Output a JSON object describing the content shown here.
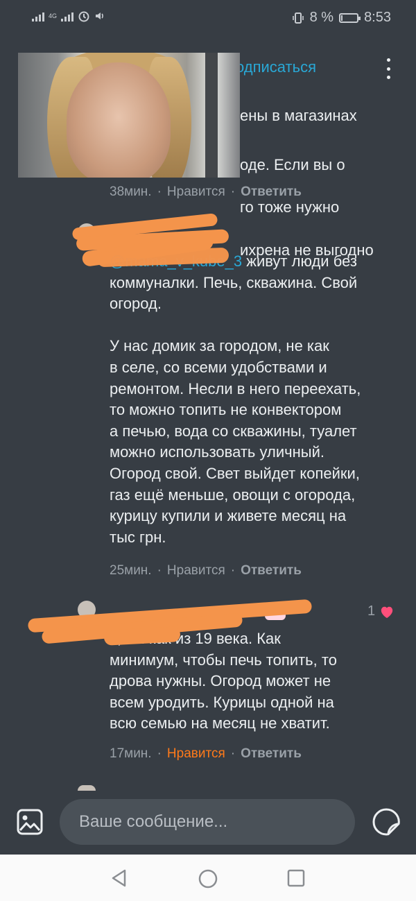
{
  "status_bar": {
    "network": "4G",
    "battery_percent": "8 %",
    "battery_level": 0.08,
    "time": "8:53"
  },
  "header": {
    "subscribe_label": "подписаться",
    "partial_subscribe_text": "одписаться"
  },
  "comments": [
    {
      "text_lines": [
        "ены в магазинах",
        "оде. Если вы о",
        "го тоже нужно",
        "ихрена не выгодно"
      ],
      "time": "38мин.",
      "like_label": "Нравится",
      "reply_label": "Ответить",
      "liked": false
    },
    {
      "mention": "@mama_v_kube_3",
      "text": " живут люди без\nкоммуналки. Печь, скважина. Свой\nогород.\n\nУ нас домик за городом, не как\nв селе, со всеми удобствами и\nремонтом. Несли в него переехать,\nто можно топить не конвектором\nа печью, вода со скважины, туалет\nможно использовать уличный.\nОгород свой. Свет выйдет копейки,\nгаз ещё меньше, овощи с огорода,\nкурицу купили и живете месяц на\nтыс грн.",
      "time": "25мин.",
      "like_label": "Нравится",
      "reply_label": "Ответить",
      "liked": false
    },
    {
      "mention": "k",
      "text": ", вы как из 19 века. Как\nминимум, чтобы печь топить, то\nдрова нужны. Огород может не\nвсем уродить. Курицы одной на\nвсю семью на месяц не хватит.",
      "time": "17мин.",
      "like_label": "Нравится",
      "reply_label": "Ответить",
      "liked": true,
      "like_count": "1"
    }
  ],
  "separator_dot": "·",
  "composer": {
    "placeholder": "Ваше сообщение..."
  },
  "colors": {
    "background": "#373d44",
    "accent": "#29a8d6",
    "liked": "#ff7a1a",
    "heart": "#ff4f7b"
  },
  "icons": {
    "gallery": "image-icon",
    "sticker": "sticker-icon",
    "menu": "more-vertical-icon",
    "back": "back-triangle-icon",
    "home": "home-circle-icon",
    "recents": "recents-square-icon"
  }
}
